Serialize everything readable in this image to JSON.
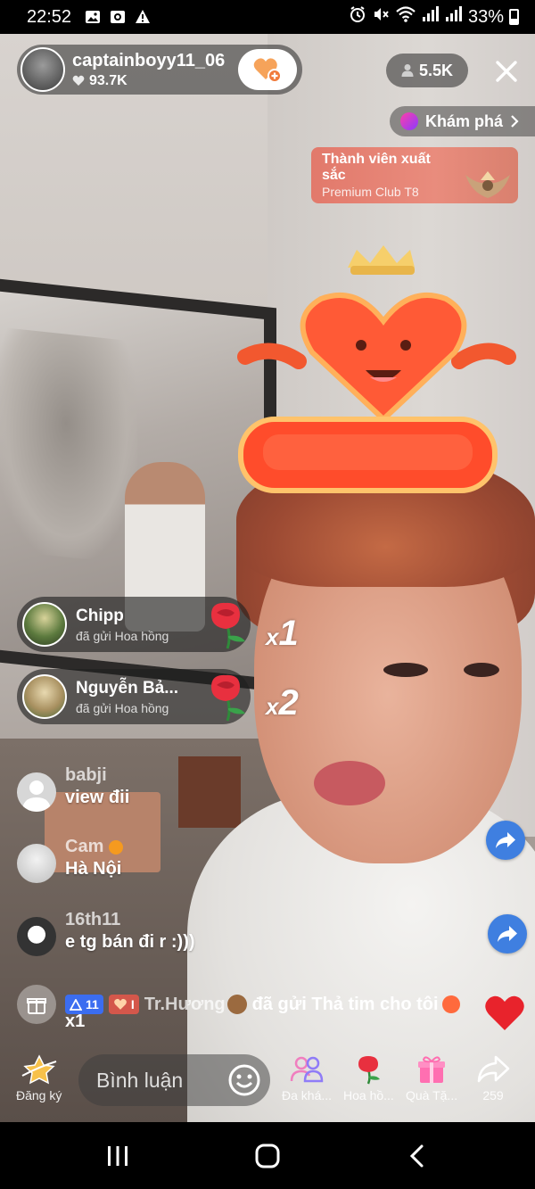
{
  "status_bar": {
    "time": "22:52",
    "battery": "33%"
  },
  "host": {
    "name": "captainboyy11_06",
    "likes": "93.7K"
  },
  "viewers": {
    "count": "5.5K"
  },
  "explore": {
    "label": "Khám phá"
  },
  "club_banner": {
    "title": "Thành viên xuất sắc",
    "subtitle": "Premium Club T8"
  },
  "gifts": [
    {
      "name": "Chipp",
      "text": "đã gửi Hoa hồng",
      "count_prefix": "x",
      "count": "1"
    },
    {
      "name": "Nguyễn Bả...",
      "text": "đã gửi Hoa hồng",
      "count_prefix": "x",
      "count": "2"
    }
  ],
  "chat": [
    {
      "user": "babji",
      "message": "view đii"
    },
    {
      "user": "Cam",
      "message": "Hà Nội"
    },
    {
      "user": "16th11",
      "message": "e tg bán đi r :)))"
    }
  ],
  "gift_line": {
    "badge_level": "11",
    "badge_fan": "I",
    "user": "Tr.Hương",
    "text": "đã gửi Thả tim cho tôi",
    "count": "x1"
  },
  "bottom_bar": {
    "subscribe_label": "Đăng ký",
    "comment_placeholder": "Bình luận",
    "guests_label": "Đa khá...",
    "rose_label": "Hoa hồ...",
    "gift_label": "Quà Tặ...",
    "share_count": "259"
  },
  "colors": {
    "accent_red": "#fe2c55",
    "share_blue": "#3f7fe0",
    "club_banner": "#e2796b"
  }
}
